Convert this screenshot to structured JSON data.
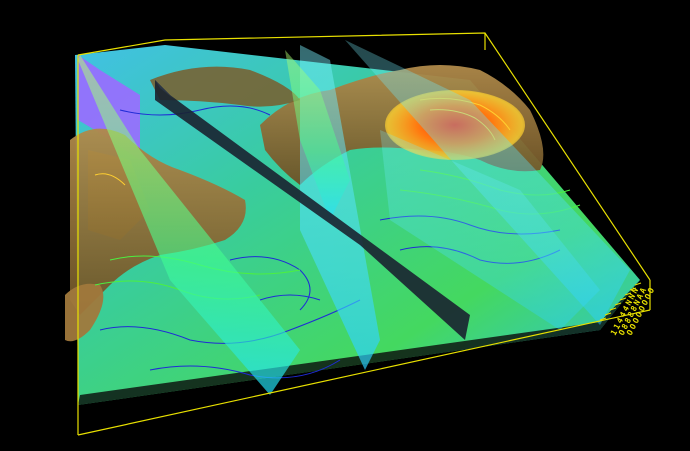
{
  "scene": {
    "colors": {
      "background": "#000000",
      "bounding_box": "#e8e000",
      "contour_low": "#1f2bd6",
      "contour_mid": "#3ee03a",
      "contour_high": "#ffcf30",
      "surface_terrain": "#8a6b2e",
      "slice_cyan": "#35d8ff",
      "slice_green": "#52ff6a",
      "slice_dark": "#1a2230",
      "hotspot": "#ff3a10",
      "violet_panel": "#9a6cff"
    },
    "axis_ticks": [
      {
        "label": "1"
      },
      {
        "label": "1"
      },
      {
        "label": "4"
      },
      {
        "label": "4"
      },
      {
        "label": "4"
      },
      {
        "label": "N"
      },
      {
        "label": "N"
      },
      {
        "label": "N"
      }
    ],
    "axis_ticks_row2": [
      {
        "label": "O"
      },
      {
        "label": "8"
      },
      {
        "label": "8"
      },
      {
        "label": "8"
      },
      {
        "label": "8"
      },
      {
        "label": "N"
      },
      {
        "label": "A"
      },
      {
        "label": "A"
      }
    ],
    "axis_ticks_row3": [
      {
        "label": "O"
      },
      {
        "label": "O"
      },
      {
        "label": "O"
      },
      {
        "label": "O"
      },
      {
        "label": "O"
      },
      {
        "label": "O"
      },
      {
        "label": "O"
      },
      {
        "label": "O"
      }
    ]
  }
}
